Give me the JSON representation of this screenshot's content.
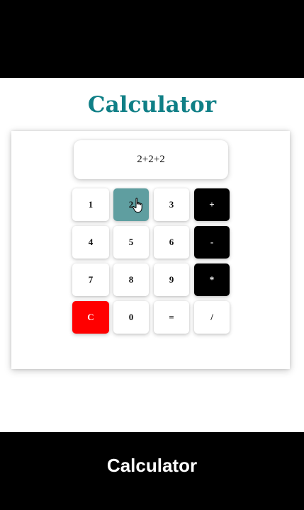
{
  "header": {
    "title": "Calculator"
  },
  "display": {
    "value": "2+2+2"
  },
  "keypad": {
    "rows": [
      [
        {
          "label": "1",
          "type": "digit"
        },
        {
          "label": "2",
          "type": "digit",
          "state": "active"
        },
        {
          "label": "3",
          "type": "digit"
        },
        {
          "label": "+",
          "type": "operator"
        }
      ],
      [
        {
          "label": "4",
          "type": "digit"
        },
        {
          "label": "5",
          "type": "digit"
        },
        {
          "label": "6",
          "type": "digit"
        },
        {
          "label": "-",
          "type": "operator"
        }
      ],
      [
        {
          "label": "7",
          "type": "digit"
        },
        {
          "label": "8",
          "type": "digit"
        },
        {
          "label": "9",
          "type": "digit"
        },
        {
          "label": "*",
          "type": "operator"
        }
      ],
      [
        {
          "label": "C",
          "type": "clear"
        },
        {
          "label": "0",
          "type": "digit"
        },
        {
          "label": "=",
          "type": "equals"
        },
        {
          "label": "/",
          "type": "divide"
        }
      ]
    ]
  },
  "caption": {
    "text": "Calculator"
  },
  "colors": {
    "title": "#0f7f86",
    "operator_bg": "#000000",
    "clear_bg": "#ff0000",
    "active_key_bg": "#5f9ea0"
  },
  "icons": {
    "pointer": "hand-pointer-icon"
  }
}
